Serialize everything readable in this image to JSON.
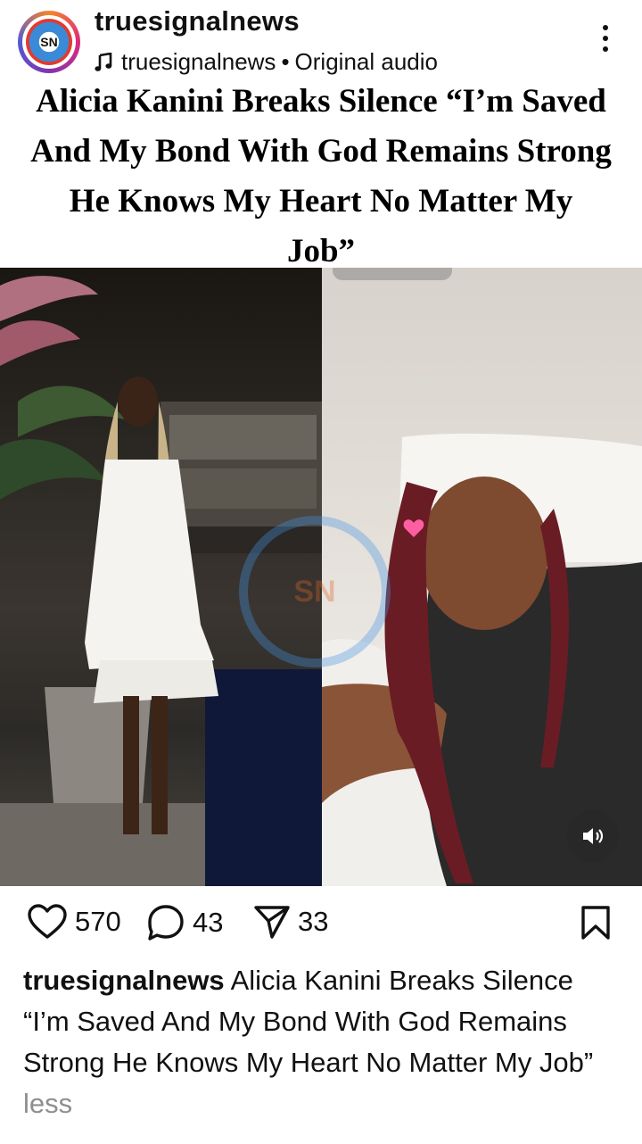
{
  "header": {
    "username": "truesignalnews",
    "avatar_text": "SN",
    "audio_user": "truesignalnews",
    "audio_separator": "•",
    "audio_label": "Original audio"
  },
  "post_image": {
    "headline_lines": [
      "Alicia Kanini Breaks Silence “I’m Saved",
      "And My Bond With God Remains Strong",
      "He Knows My Heart No Matter My",
      "Job”"
    ],
    "watermark_text": "SN"
  },
  "actions": {
    "likes": "570",
    "comments": "43",
    "shares": "33"
  },
  "caption": {
    "username": "truesignalnews",
    "text": "Alicia Kanini Breaks Silence “I’m Saved And My Bond With God Remains Strong He Knows My Heart No Matter My Job”",
    "less_label": "less"
  },
  "icons": {
    "header": [
      "music-note-icon",
      "more-options-icon"
    ],
    "media": [
      "volume-icon"
    ],
    "actions": [
      "heart-icon",
      "comment-icon",
      "share-icon",
      "bookmark-icon"
    ]
  }
}
